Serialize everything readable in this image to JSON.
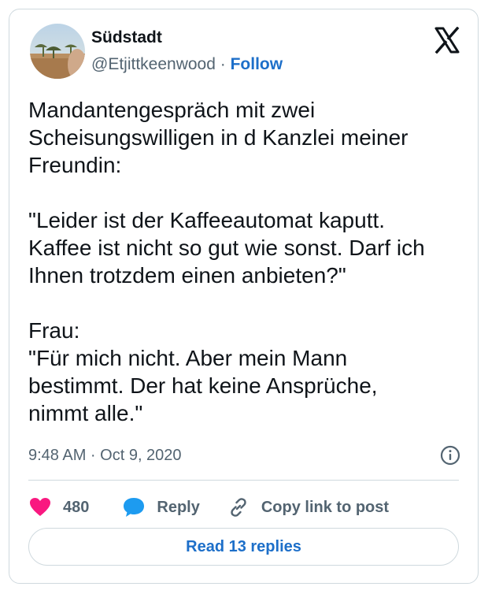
{
  "author": {
    "display_name": "Südstadt",
    "handle": "@Etjittkeenwood",
    "separator": "·",
    "follow_label": "Follow"
  },
  "tweet": {
    "paragraphs": [
      [
        "Mandantengespräch mit zwei",
        "Scheisungswilligen in d Kanzlei meiner",
        "Freundin:"
      ],
      [
        "\"Leider ist der Kaffeeautomat kaputt.",
        "Kaffee ist nicht so gut wie sonst. Darf ich",
        "Ihnen trotzdem einen anbieten?\""
      ],
      [
        "Frau:",
        "\"Für mich nicht. Aber mein Mann",
        "bestimmt. Der hat keine Ansprüche,",
        "nimmt alle.\""
      ]
    ],
    "timestamp": "9:48 AM · Oct 9, 2020"
  },
  "actions": {
    "like_count": "480",
    "reply_label": "Reply",
    "copy_link_label": "Copy link to post"
  },
  "read_replies_label": "Read 13 replies",
  "icons": {
    "brand": "x-logo-icon",
    "info": "info-icon",
    "like": "heart-icon",
    "reply": "speech-bubble-icon",
    "copy_link": "link-icon"
  },
  "colors": {
    "link_blue": "#1d6fc9",
    "heart_pink": "#f91880",
    "reply_blue": "#1d9bf0",
    "muted_gray": "#536471",
    "border": "#cfd9de"
  }
}
